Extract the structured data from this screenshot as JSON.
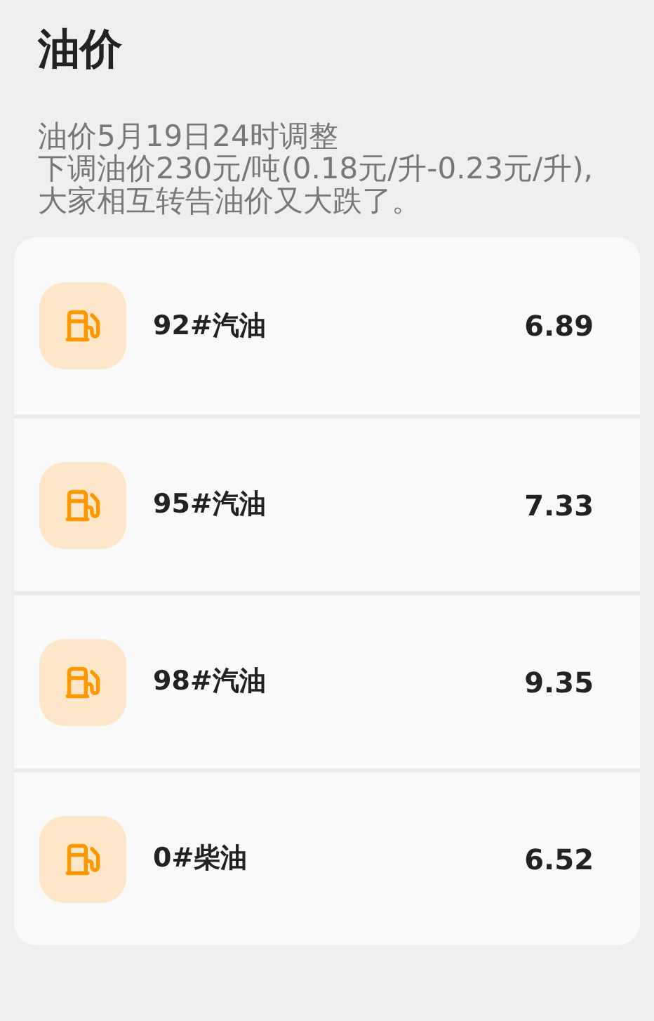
{
  "title": "油价",
  "notice": [
    "油价5月19日24时调整",
    "下调油价230元/吨(0.18元/升-0.23元/升),大家相互转告油价又大跌了。"
  ],
  "prices": [
    {
      "name": "92#汽油",
      "price": "6.89"
    },
    {
      "name": "95#汽油",
      "price": "7.33"
    },
    {
      "name": "98#汽油",
      "price": "9.35"
    },
    {
      "name": "0#柴油",
      "price": "6.52"
    }
  ]
}
